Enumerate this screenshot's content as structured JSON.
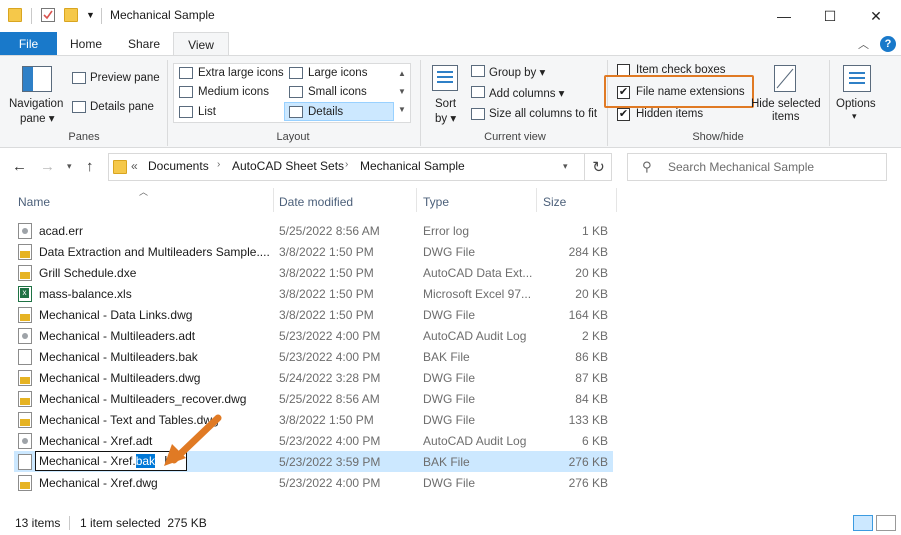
{
  "window": {
    "title": "Mechanical Sample",
    "minimize_glyph": "—",
    "maximize_glyph": "☐",
    "close_glyph": "✕"
  },
  "tabs": [
    {
      "label": "File"
    },
    {
      "label": "Home"
    },
    {
      "label": "Share"
    },
    {
      "label": "View"
    }
  ],
  "ribbon": {
    "panes": {
      "navigation_pane": "Navigation",
      "navigation_pane_2": "pane ▾",
      "preview_pane": "Preview pane",
      "details_pane": "Details pane",
      "label": "Panes"
    },
    "layout": {
      "items": [
        "Extra large icons",
        "Large icons",
        "Medium icons",
        "Small icons",
        "List",
        "Details"
      ],
      "label": "Layout"
    },
    "current_view": {
      "sort_by": "Sort",
      "sort_by_2": "by ▾",
      "group_by": "Group by ▾",
      "add_columns": "Add columns ▾",
      "size_all": "Size all columns to fit",
      "label": "Current view"
    },
    "show_hide": {
      "item_check_boxes": "Item check boxes",
      "file_name_extensions": "File name extensions",
      "hidden_items": "Hidden items",
      "hide_selected": "Hide selected",
      "hide_selected_2": "items",
      "label": "Show/hide"
    },
    "options": {
      "label": "Options",
      "arrow": "▾"
    }
  },
  "address": {
    "crumbs": [
      "«",
      "Documents",
      "AutoCAD Sheet Sets",
      "Mechanical Sample"
    ],
    "search_placeholder": "Search Mechanical Sample"
  },
  "columns": {
    "name": "Name",
    "date": "Date modified",
    "type": "Type",
    "size": "Size"
  },
  "files": [
    {
      "name": "acad.err",
      "date": "5/25/2022 8:56 AM",
      "type": "Error log",
      "size": "1 KB",
      "icon": "err"
    },
    {
      "name": "Data Extraction and Multileaders Sample....",
      "date": "3/8/2022 1:50 PM",
      "type": "DWG File",
      "size": "284 KB",
      "icon": "dwg"
    },
    {
      "name": "Grill Schedule.dxe",
      "date": "3/8/2022 1:50 PM",
      "type": "AutoCAD Data Ext...",
      "size": "20 KB",
      "icon": "dwg"
    },
    {
      "name": "mass-balance.xls",
      "date": "3/8/2022 1:50 PM",
      "type": "Microsoft Excel 97...",
      "size": "20 KB",
      "icon": "xls"
    },
    {
      "name": "Mechanical - Data Links.dwg",
      "date": "3/8/2022 1:50 PM",
      "type": "DWG File",
      "size": "164 KB",
      "icon": "dwg"
    },
    {
      "name": "Mechanical - Multileaders.adt",
      "date": "5/23/2022 4:00 PM",
      "type": "AutoCAD Audit Log",
      "size": "2 KB",
      "icon": "adt"
    },
    {
      "name": "Mechanical - Multileaders.bak",
      "date": "5/23/2022 4:00 PM",
      "type": "BAK File",
      "size": "86 KB",
      "icon": "bak"
    },
    {
      "name": "Mechanical - Multileaders.dwg",
      "date": "5/24/2022 3:28 PM",
      "type": "DWG File",
      "size": "87 KB",
      "icon": "dwg"
    },
    {
      "name": "Mechanical - Multileaders_recover.dwg",
      "date": "5/25/2022 8:56 AM",
      "type": "DWG File",
      "size": "84 KB",
      "icon": "dwg"
    },
    {
      "name": "Mechanical - Text and Tables.dwg",
      "date": "3/8/2022 1:50 PM",
      "type": "DWG File",
      "size": "133 KB",
      "icon": "dwg"
    },
    {
      "name": "Mechanical - Xref.adt",
      "date": "5/23/2022 4:00 PM",
      "type": "AutoCAD Audit Log",
      "size": "6 KB",
      "icon": "adt"
    },
    {
      "name": "",
      "date": "5/23/2022 3:59 PM",
      "type": "BAK File",
      "size": "276 KB",
      "icon": "bak"
    },
    {
      "name": "Mechanical - Xref.dwg",
      "date": "5/23/2022 4:00 PM",
      "type": "DWG File",
      "size": "276 KB",
      "icon": "dwg"
    }
  ],
  "rename": {
    "base": "Mechanical - Xref.",
    "ext": "bak"
  },
  "status": {
    "count": "13 items",
    "selected": "1 item selected  275 KB"
  },
  "colors": {
    "accent": "#1979ca",
    "highlight": "#e07a24",
    "selection": "#cce8ff"
  }
}
